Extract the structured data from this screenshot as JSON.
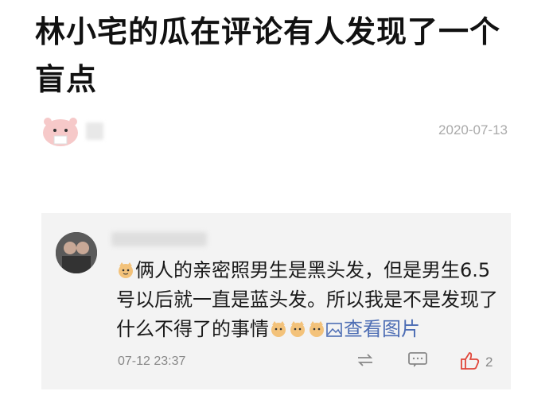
{
  "article": {
    "title": "林小宅的瓜在评论有人发现了一个盲点",
    "date": "2020-07-13"
  },
  "comment": {
    "text_part1": "俩人的亲密照男生是黑头发，但是男生6.5号以后就一直是蓝头发。所以我是不是发现了什么不得了的事情",
    "view_image_label": "查看图片",
    "time": "07-12 23:37",
    "like_count": "2"
  },
  "icons": [
    "cat-emoji-icon",
    "image-icon",
    "repost-icon",
    "comment-icon",
    "like-icon"
  ],
  "colors": {
    "link": "#4d6db4",
    "like": "#e0463a",
    "box": "#f3f3f3"
  }
}
